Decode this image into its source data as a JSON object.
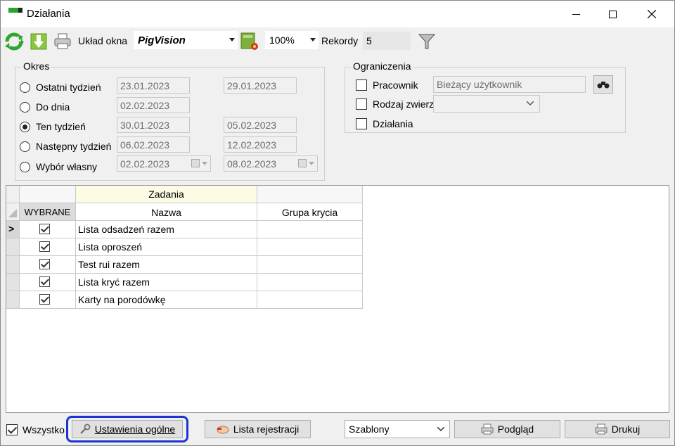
{
  "window": {
    "title": "Działania"
  },
  "toolbar": {
    "uklad_label": "Układ okna",
    "uklad_value": "PigVision",
    "zoom_value": "100%",
    "rekordy_label": "Rekordy",
    "rekordy_value": "5"
  },
  "okres": {
    "title": "Okres",
    "rows": [
      {
        "label": "Ostatni tydzień",
        "from": "23.01.2023",
        "to": "29.01.2023",
        "selected": false
      },
      {
        "label": "Do dnia",
        "from": "02.02.2023",
        "to": "",
        "selected": false
      },
      {
        "label": "Ten tydzień",
        "from": "30.01.2023",
        "to": "05.02.2023",
        "selected": true
      },
      {
        "label": "Następny tydzień",
        "from": "06.02.2023",
        "to": "12.02.2023",
        "selected": false
      },
      {
        "label": "Wybór własny",
        "from": "02.02.2023",
        "to": "08.02.2023",
        "selected": false
      }
    ]
  },
  "ograniczenia": {
    "title": "Ograniczenia",
    "pracownik_label": "Pracownik",
    "pracownik_value": "Bieżący użytkownik",
    "rodzaj_label": "Rodzaj zwierząt",
    "dzialania_label": "Działania"
  },
  "grid": {
    "group_header": "Zadania",
    "col_selected": "WYBRANE",
    "col_name": "Nazwa",
    "col_group": "Grupa krycia",
    "current_row_marker": ">",
    "rows": [
      {
        "name": "Lista odsadzeń razem",
        "group": "",
        "checked": true
      },
      {
        "name": "Lista oproszeń",
        "group": "",
        "checked": true
      },
      {
        "name": "Test rui razem",
        "group": "",
        "checked": true
      },
      {
        "name": "Lista kryć razem",
        "group": "",
        "checked": true
      },
      {
        "name": "Karty na porodówkę",
        "group": "",
        "checked": true
      }
    ]
  },
  "bottom": {
    "wszystko_label": "Wszystko",
    "ustawienia_label": "Ustawienia ogólne",
    "lista_label": "Lista rejestracji",
    "szablony_value": "Szablony",
    "podglad_label": "Podgląd",
    "drukuj_label": "Drukuj"
  },
  "colors": {
    "highlight": "#1a34d6",
    "grid_header_group": "#fdfbe3"
  }
}
